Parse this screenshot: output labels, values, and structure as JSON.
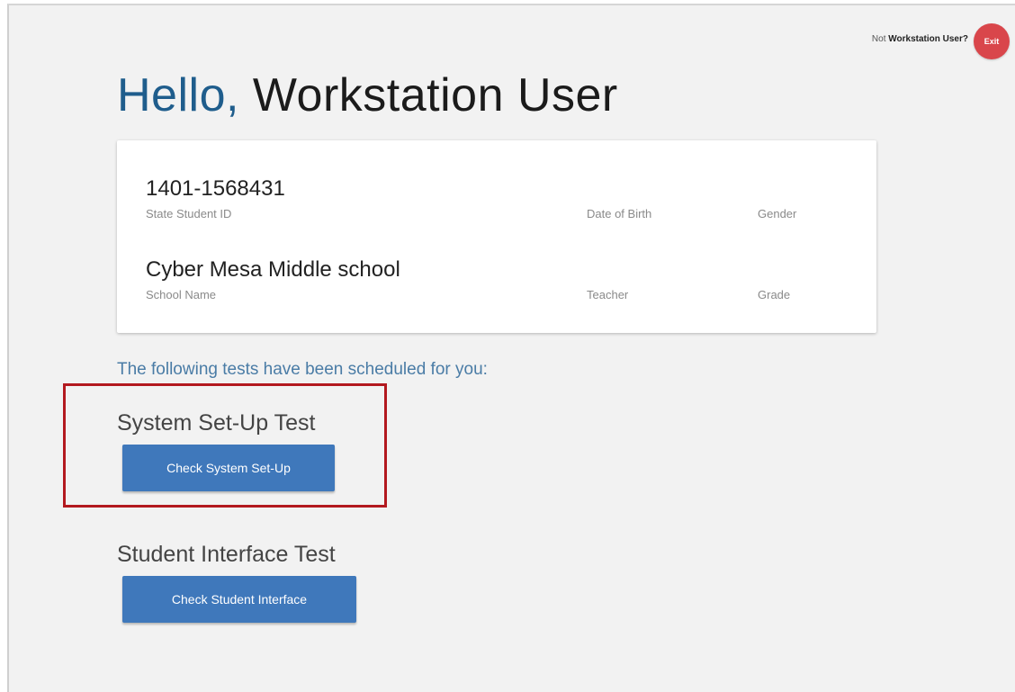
{
  "header": {
    "not_user_prefix": "Not",
    "user_name": "Workstation User?",
    "exit_label": "Exit"
  },
  "greeting": {
    "hello": "Hello,",
    "name": "Workstation User"
  },
  "student_card": {
    "student_id": "1401-1568431",
    "student_id_label": "State Student ID",
    "dob_label": "Date of Birth",
    "gender_label": "Gender",
    "school_name": "Cyber Mesa Middle school",
    "school_name_label": "School Name",
    "teacher_label": "Teacher",
    "grade_label": "Grade"
  },
  "scheduled_text": "The following tests have been scheduled for you:",
  "tests": [
    {
      "title": "System Set-Up Test",
      "button_label": "Check System Set-Up"
    },
    {
      "title": "Student Interface Test",
      "button_label": "Check Student Interface"
    }
  ],
  "colors": {
    "accent_blue": "#3f78bb",
    "hello_blue": "#1f5d8c",
    "exit_red": "#d9464b",
    "highlight_red": "#b3191f"
  }
}
